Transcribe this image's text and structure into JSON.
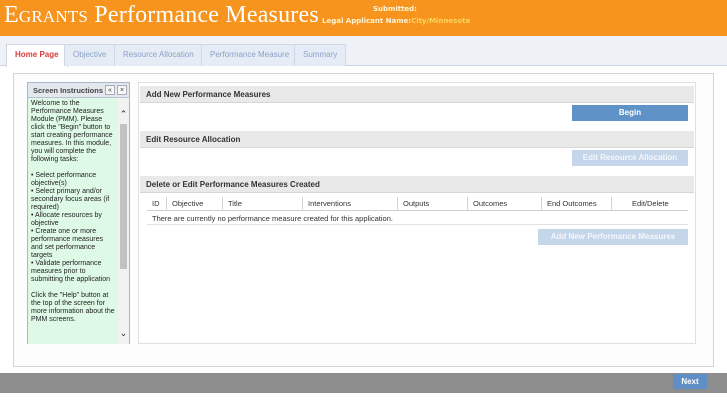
{
  "header": {
    "title_first_letter": "E",
    "title_small_caps": "GRANTS",
    "title_rest": "Performance Measures",
    "submitted_label": "Submitted:",
    "legal_label": "Legal Applicant Name:",
    "legal_value": "City/Minnesota"
  },
  "tabs": [
    {
      "label": "Home Page",
      "active": true
    },
    {
      "label": "Objective"
    },
    {
      "label": "Resource Allocation"
    },
    {
      "label": "Performance Measure"
    },
    {
      "label": "Summary"
    }
  ],
  "instructions": {
    "title": "Screen Instructions",
    "collapse_label": "«",
    "close_label": "×",
    "intro": "Welcome to the Performance Measures Module (PMM). Please click the \"Begin\" button to start creating performance measures. In this module, you will complete the following tasks:",
    "tasks": [
      "• Select performance objective(s)",
      "• Select primary and/or secondary focus areas (if required)",
      "• Allocate resources by objective",
      "• Create one or more performance measures and set performance targets",
      "• Validate performance measures prior to submitting the application"
    ],
    "help": "Click the \"Help\" button at the top of the screen for more information about the PMM screens."
  },
  "sections": {
    "add": {
      "title": "Add New Performance Measures",
      "button": "Begin"
    },
    "edit_alloc": {
      "title": "Edit Resource Allocation",
      "button": "Edit Resource Allocation"
    },
    "delete_edit": {
      "title": "Delete or Edit Performance Measures Created",
      "button": "Add New Performance Measures"
    }
  },
  "table": {
    "columns": [
      "ID",
      "Objective",
      "Title",
      "Interventions",
      "Outputs",
      "Outcomes",
      "End Outcomes",
      "Edit/Delete"
    ],
    "empty_message": "There are currently no performance measure created for this application."
  },
  "footer": {
    "next_label": "Next"
  },
  "colors": {
    "header_orange": "#f7941d",
    "active_tab_text": "#d93a3a",
    "primary_button": "#5f93c8",
    "instructions_bg": "#dff9e7"
  }
}
